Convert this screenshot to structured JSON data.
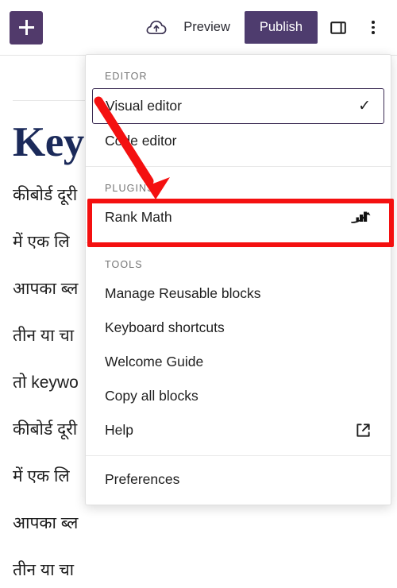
{
  "toolbar": {
    "add_block_label": "+",
    "add_block_name": "add-block",
    "save_draft_icon": "cloud-upload-icon",
    "preview_label": "Preview",
    "publish_label": "Publish",
    "sidebar_toggle_icon": "sidebar-panel-icon",
    "more_options_icon": "kebab-menu-icon",
    "publish_color": "#4e3c6e",
    "add_block_color": "#513a6b"
  },
  "post": {
    "title": "Key",
    "title_color": "#1b2a5a",
    "paragraphs": [
      "कीबोर्ड दूरी",
      "में एक लि",
      "आपका ब्ल",
      "तीन या चा",
      "तो keywo",
      "कीबोर्ड दूरी",
      "में एक लि",
      "आपका ब्ल",
      "तीन या चा"
    ]
  },
  "menu": {
    "sections": [
      {
        "label": "EDITOR",
        "items": [
          {
            "label": "Visual editor",
            "selected": true,
            "trailing": "check-mark-icon"
          },
          {
            "label": "Code editor",
            "selected": false,
            "trailing": ""
          }
        ]
      },
      {
        "label": "PLUGINS",
        "items": [
          {
            "label": "Rank Math",
            "selected": false,
            "trailing": "rank-math-icon"
          }
        ]
      },
      {
        "label": "TOOLS",
        "items": [
          {
            "label": "Manage Reusable blocks",
            "selected": false,
            "trailing": ""
          },
          {
            "label": "Keyboard shortcuts",
            "selected": false,
            "trailing": ""
          },
          {
            "label": "Welcome Guide",
            "selected": false,
            "trailing": ""
          },
          {
            "label": "Copy all blocks",
            "selected": false,
            "trailing": ""
          },
          {
            "label": "Help",
            "selected": false,
            "trailing": "external-link-icon"
          }
        ]
      },
      {
        "label": "",
        "items": [
          {
            "label": "Preferences",
            "selected": false,
            "trailing": ""
          }
        ]
      }
    ]
  },
  "annotations": {
    "highlight_color": "#f41010",
    "arrow_color": "#f41010",
    "highlight_target": "Rank Math",
    "checkmark_glyph": "✓"
  }
}
